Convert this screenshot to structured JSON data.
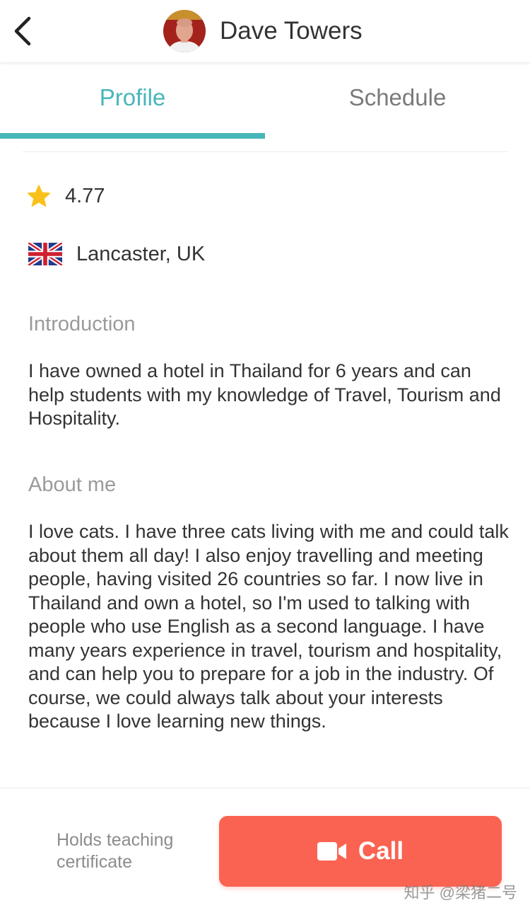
{
  "header": {
    "title": "Dave Towers",
    "back_icon": "chevron-left-icon",
    "avatar_icon": "user-avatar"
  },
  "tabs": [
    {
      "label": "Profile",
      "active": true
    },
    {
      "label": "Schedule",
      "active": false
    }
  ],
  "profile": {
    "rating": "4.77",
    "rating_icon": "star-icon",
    "location": "Lancaster, UK",
    "flag_icon": "uk-flag-icon",
    "introduction": {
      "heading": "Introduction",
      "text": "I have owned a hotel in Thailand for 6 years and can help students with my knowledge of Travel, Tourism and Hospitality."
    },
    "about": {
      "heading": "About me",
      "text": "I love cats. I have three cats living with me and could talk about them all day! I also enjoy travelling and meeting people, having visited 26 countries so far. I now live in Thailand and own a hotel, so I'm used to talking with people who use English as a second language. I have many years experience in travel, tourism and hospitality, and can help you to prepare for a job in the industry. Of course, we could always talk about your interests because I love learning new things."
    }
  },
  "footer": {
    "certificate_text": "Holds teaching certificate",
    "call_label": "Call",
    "call_icon": "video-camera-icon"
  },
  "watermark": "知乎 @梁猪二号",
  "colors": {
    "accent": "#47b6b9",
    "call_button": "#fa6351",
    "star": "#f9c21b"
  }
}
